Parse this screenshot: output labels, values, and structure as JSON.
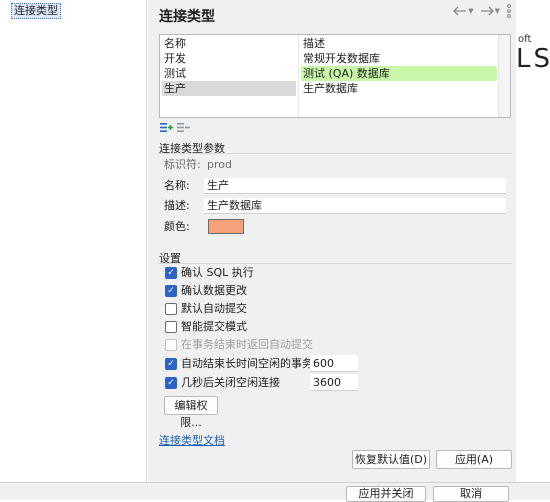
{
  "sidebar": {
    "selected_item": "连接类型"
  },
  "panel": {
    "title": "连接类型",
    "icons": [
      "back-arrow-icon",
      "forward-arrow-icon",
      "more-menu-icon"
    ],
    "table": {
      "headers": [
        "名称",
        "描述"
      ],
      "rows": [
        {
          "name": "开发",
          "description": "常规开发数据库",
          "color": ""
        },
        {
          "name": "测试",
          "description": "测试 (QA) 数据库",
          "color": "#c8f7a9"
        },
        {
          "name": "生产",
          "description": "生产数据库",
          "color": "#f7a07c",
          "selected": true
        }
      ]
    },
    "params": {
      "group_label": "连接类型参数",
      "id_label": "标识符:",
      "id_value": "prod",
      "name_label": "名称:",
      "name_value": "生产",
      "desc_label": "描述:",
      "desc_value": "生产数据库",
      "color_label": "颜色:",
      "color_value": "#f7a07c"
    },
    "settings": {
      "group_label": "设置",
      "confirm_sql": {
        "label": "确认 SQL 执行",
        "checked": true
      },
      "confirm_data": {
        "label": "确认数据更改",
        "checked": true
      },
      "auto_commit": {
        "label": "默认自动提交",
        "checked": false
      },
      "smart_commit": {
        "label": "智能提交模式",
        "checked": false
      },
      "return_auto_commit": {
        "label": "在事务结束时返回自动提交",
        "checked": false,
        "disabled": true
      },
      "end_idle_txn": {
        "label": "自动结束长时间空闲的事务",
        "checked": true,
        "value": "600"
      },
      "close_idle_conn": {
        "label": "几秒后关闭空闲连接",
        "checked": true,
        "value": "3600"
      },
      "edit_permissions": "编辑权限..."
    },
    "doc_link": "连接类型文档",
    "restore_defaults": "恢复默认值(D)",
    "apply": "应用(A)"
  },
  "footer": {
    "apply_close": "应用并关闭",
    "cancel": "取消"
  },
  "background": {
    "partial_text_1": "oft",
    "partial_text_2": "LS"
  }
}
